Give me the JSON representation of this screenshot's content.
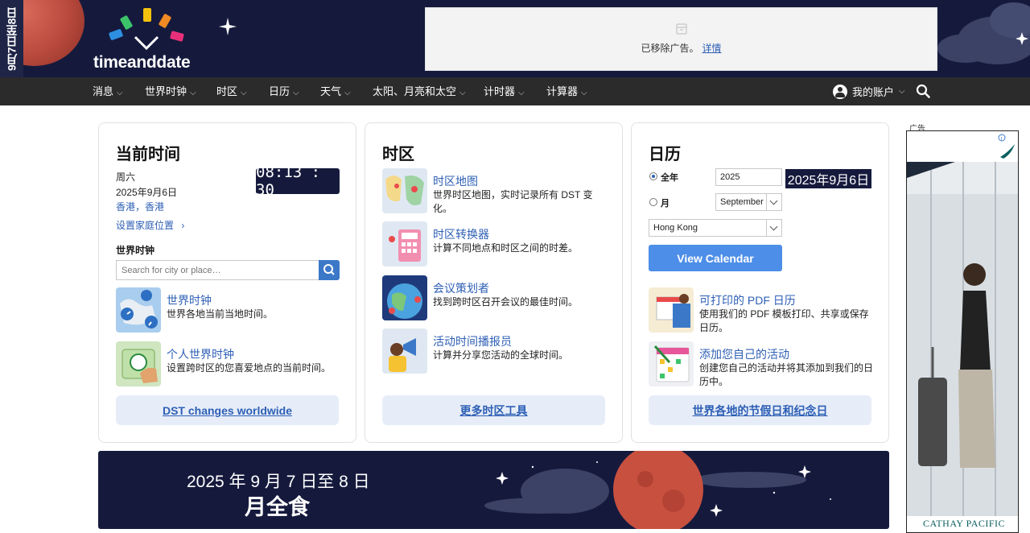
{
  "banner": {
    "vertical_text": "9月7日至8日",
    "logo_text": "timeanddate",
    "ad_removed": "已移除广告。",
    "ad_details": "详情"
  },
  "nav": {
    "items": [
      "消息",
      "世界时钟",
      "时区",
      "日历",
      "天气",
      "太阳、月亮和太空",
      "计时器",
      "计算器"
    ],
    "account": "我的账户"
  },
  "current_time": {
    "title": "当前时间",
    "weekday": "周六",
    "date": "2025年9月6日",
    "location": "香港，香港",
    "clock": "08:13 : 30",
    "set_home": "设置家庭位置",
    "world_clock_heading": "世界时钟",
    "search_placeholder": "Search for city or place…",
    "features": [
      {
        "title": "世界时钟",
        "desc": "世界各地当前当地时间。"
      },
      {
        "title": "个人世界时钟",
        "desc": "设置跨时区的您喜爱地点的当前时间。"
      }
    ],
    "button": "DST changes worldwide"
  },
  "timezones": {
    "title": "时区",
    "features": [
      {
        "title": "时区地图",
        "desc": "世界时区地图，实时记录所有 DST 变化。"
      },
      {
        "title": "时区转换器",
        "desc": "计算不同地点和时区之间的时差。"
      },
      {
        "title": "会议策划者",
        "desc": "找到跨时区召开会议的最佳时间。"
      },
      {
        "title": "活动时间播报员",
        "desc": "计算并分享您活动的全球时间。"
      }
    ],
    "button": "更多时区工具"
  },
  "calendar": {
    "title": "日历",
    "radio_year": "全年",
    "radio_month": "月",
    "year_value": "2025",
    "month_value": "September",
    "location_value": "Hong Kong",
    "date_badge": "2025年9月6日",
    "view_button": "View Calendar",
    "features": [
      {
        "title": "可打印的 PDF 日历",
        "desc": "使用我们的 PDF 模板打印、共享或保存日历。"
      },
      {
        "title": "添加您自己的活动",
        "desc": "创建您自己的活动并将其添加到我们的日历中。"
      }
    ],
    "button": "世界各地的节假日和纪念日"
  },
  "eclipse_banner": {
    "line1": "2025 年 9 月 7 日至 8 日",
    "line2": "月全食"
  },
  "side_ad": {
    "label": "广告",
    "brand": "CATHAY PACIFIC"
  }
}
